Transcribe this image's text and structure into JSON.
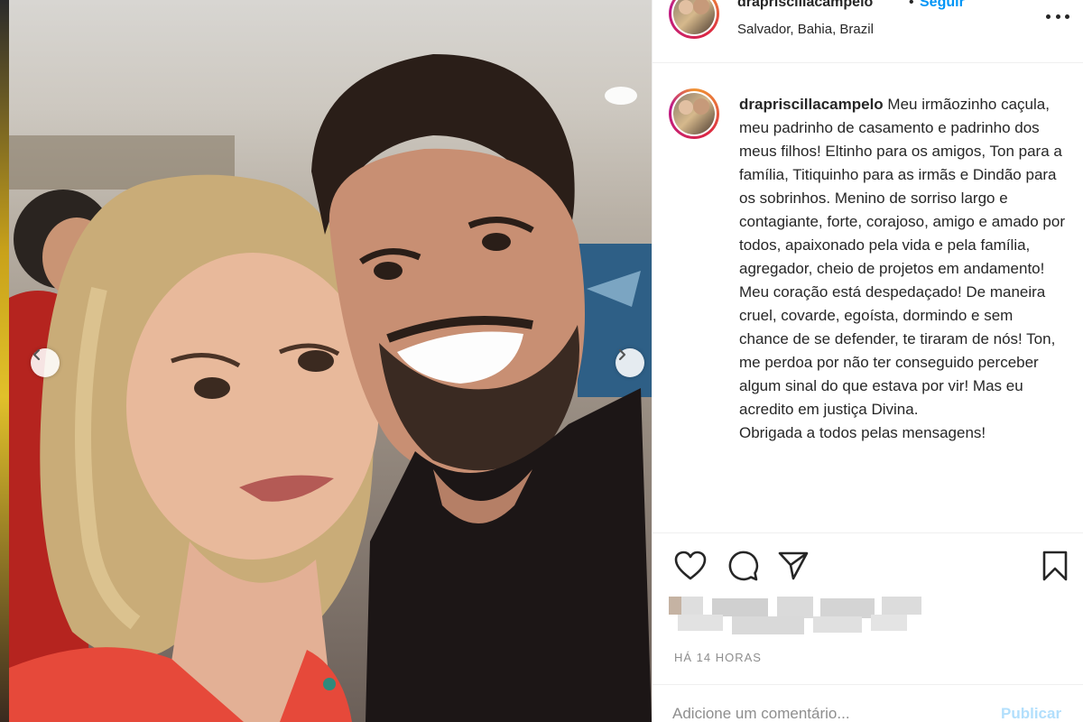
{
  "post": {
    "username": "drapriscillacampelo",
    "separator": "•",
    "follow_label": "Seguir",
    "location": "Salvador, Bahia, Brazil",
    "caption": "Meu irmãozinho caçula, meu padrinho de casamento e padrinho dos meus filhos! Eltinho para os amigos, Ton para a família, Titiquinho para as irmãs e Dindão para os sobrinhos. Menino de sorriso largo e contagiante, forte, corajoso, amigo e amado por todos, apaixonado pela vida e pela família, agregador, cheio de projetos em andamento! Meu coração está despedaçado! De maneira cruel, covarde, egoísta, dormindo e sem chance de se defender, te tiraram de nós! Ton, me perdoa por não ter conseguido perceber algum sinal do que estava por vir! Mas eu acredito em justiça Divina.\nObrigada a todos pelas mensagens!",
    "timestamp": "HÁ 14 HORAS"
  },
  "comment": {
    "placeholder": "Adicione um comentário...",
    "publish_label": "Publicar"
  },
  "colors": {
    "accent": "#0095f6",
    "publish_disabled": "#b2dffc",
    "muted": "#8e8e8e"
  },
  "icons": {
    "more": "more-options-icon",
    "like": "heart-icon",
    "comment": "comment-icon",
    "share": "paper-plane-icon",
    "save": "bookmark-icon",
    "prev": "chevron-left-icon",
    "next": "chevron-right-icon"
  }
}
